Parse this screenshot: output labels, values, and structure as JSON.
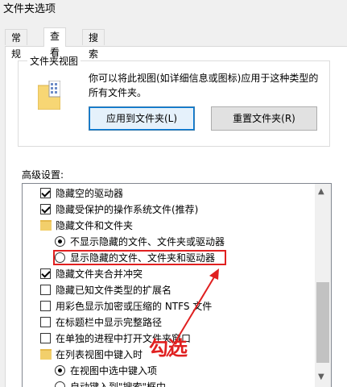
{
  "window": {
    "title": "文件夹选项"
  },
  "tabs": [
    {
      "label": "常规"
    },
    {
      "label": "查看"
    },
    {
      "label": "搜索"
    }
  ],
  "folder_view": {
    "group_label": "文件夹视图",
    "description": "你可以将此视图(如详细信息或图标)应用于这种类型的所有文件夹。",
    "apply_button": "应用到文件夹(L)",
    "reset_button": "重置文件夹(R)"
  },
  "advanced": {
    "label": "高级设置:",
    "items": [
      {
        "type": "checkbox",
        "checked": true,
        "label": "隐藏空的驱动器"
      },
      {
        "type": "checkbox",
        "checked": true,
        "label": "隐藏受保护的操作系统文件(推荐)"
      },
      {
        "type": "folder",
        "label": "隐藏文件和文件夹"
      },
      {
        "type": "radio",
        "checked": true,
        "label": "不显示隐藏的文件、文件夹或驱动器"
      },
      {
        "type": "radio",
        "checked": false,
        "label": "显示隐藏的文件、文件夹和驱动器"
      },
      {
        "type": "checkbox",
        "checked": true,
        "label": "隐藏文件夹合并冲突"
      },
      {
        "type": "checkbox",
        "checked": false,
        "label": "隐藏已知文件类型的扩展名"
      },
      {
        "type": "checkbox",
        "checked": false,
        "label": "用彩色显示加密或压缩的 NTFS 文件"
      },
      {
        "type": "checkbox",
        "checked": false,
        "label": "在标题栏中显示完整路径"
      },
      {
        "type": "checkbox",
        "checked": false,
        "label": "在单独的进程中打开文件夹窗口"
      },
      {
        "type": "folder",
        "label": "在列表视图中键入时"
      },
      {
        "type": "radio",
        "checked": true,
        "label": "在视图中选中键入项"
      },
      {
        "type": "radio",
        "checked": false,
        "label": "自动键入到\"搜索\"框中"
      }
    ]
  },
  "annotation": {
    "text": "勾选"
  },
  "colors": {
    "annotation": "#e02020",
    "accent": "#0078d7"
  }
}
